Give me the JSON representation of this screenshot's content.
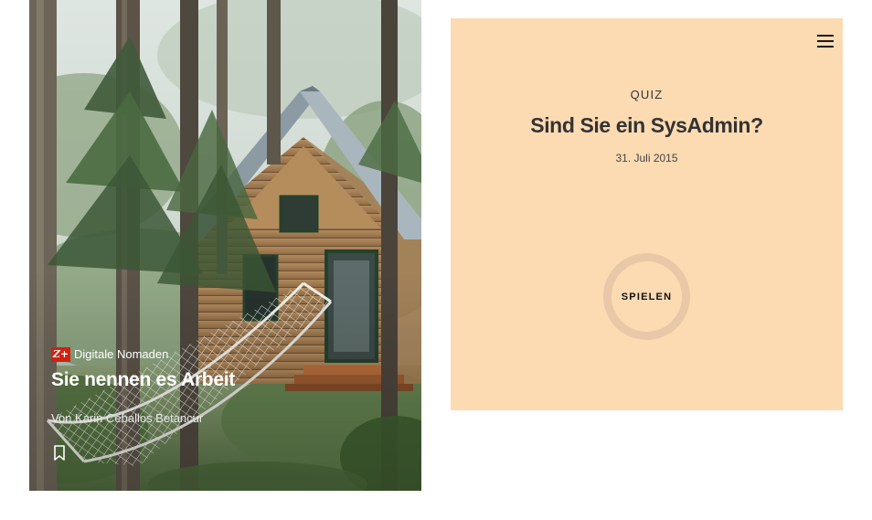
{
  "article": {
    "badge": "Z+",
    "kicker": "Digitale Nomaden",
    "title": "Sie nennen es Arbeit",
    "byline": "Von Karin Ceballos Betancur",
    "bookmark_icon": "bookmark-icon",
    "badge_color": "#d1210f"
  },
  "quiz": {
    "label": "QUIZ",
    "title": "Sind Sie ein SysAdmin?",
    "date": "31. Juli 2015",
    "play_label": "SPIELEN",
    "menu_icon": "menu-icon",
    "background": "#fcdbb3"
  }
}
